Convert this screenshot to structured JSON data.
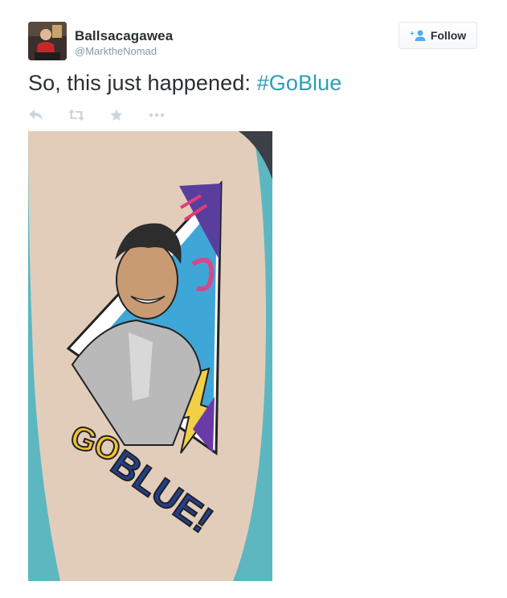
{
  "user": {
    "display_name": "Ballsacagawea",
    "handle": "@MarktheNomad",
    "avatar_icon": "user-avatar"
  },
  "follow_button": {
    "label": "Follow",
    "icon": "add-user-icon"
  },
  "tweet": {
    "text": "So, this just happened: ",
    "hashtag": "#GoBlue"
  },
  "actions": [
    {
      "icon": "reply-icon"
    },
    {
      "icon": "retweet-icon"
    },
    {
      "icon": "favorite-icon"
    },
    {
      "icon": "more-icon"
    }
  ],
  "photo": {
    "tattoo_top_text": "GO",
    "tattoo_bottom_text": "BLUE!"
  },
  "colors": {
    "hashtag": "#2b9fb5",
    "action_icon": "#ccd6dd",
    "handle": "#8899a6"
  }
}
